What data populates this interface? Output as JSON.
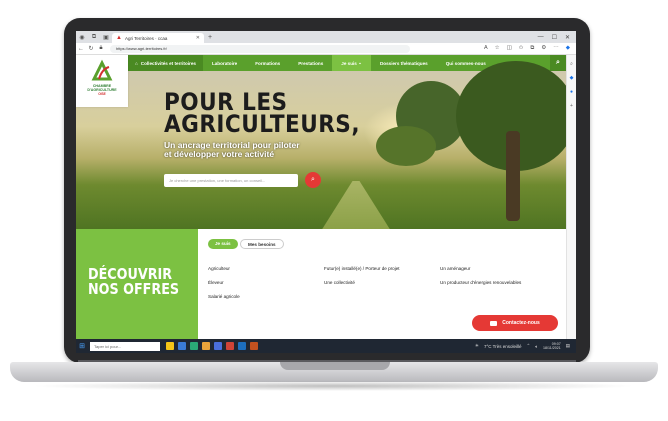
{
  "browser": {
    "tab_title": "Agri Territoires · ccaa",
    "url": "https://www.agri-territoires.fr/",
    "colors": {
      "chrome": "#dfe1e5",
      "accent": "#1a73e8"
    }
  },
  "site": {
    "logo": {
      "line1": "CHAMBRE",
      "line2": "D'AGRICULTURE",
      "line3": "OISE"
    },
    "nav": {
      "collectivites": "Collectivités et territoires",
      "items": [
        "Laboratoire",
        "Formations",
        "Prestations",
        "Je suis",
        "Dossiers thématiques",
        "Qui sommes-nous"
      ]
    },
    "hero": {
      "title_line1": "POUR LES",
      "title_line2": "AGRICULTEURS,",
      "subtitle_line1": "Un ancrage territorial pour piloter",
      "subtitle_line2": "et développer votre activité",
      "search_placeholder": "Je cherche une prestation, une formation, un conseil..."
    },
    "offers": {
      "title_line1": "DÉCOUVRIR",
      "title_line2": "NOS OFFRES"
    },
    "panel": {
      "tab_active": "Je suis",
      "tab_inactive": "Mes besoins",
      "col1": [
        "Agriculteur",
        "Éleveur",
        "Salarié agricole"
      ],
      "col2": [
        "Futur(e) installé(e) / Porteur de projet",
        "Une collectivité"
      ],
      "col3": [
        "Un aménageur",
        "Un producteur d'énergies renouvelables"
      ]
    },
    "contact_label": "Contactez-nous",
    "colors": {
      "green": "#5aa02c",
      "light_green": "#7cc142",
      "red": "#e53935"
    }
  },
  "taskbar": {
    "search_placeholder": "Taper ici pour...",
    "weather": "7°C  Très ensoleillé",
    "time": "09:07",
    "date": "18/11/2021"
  }
}
